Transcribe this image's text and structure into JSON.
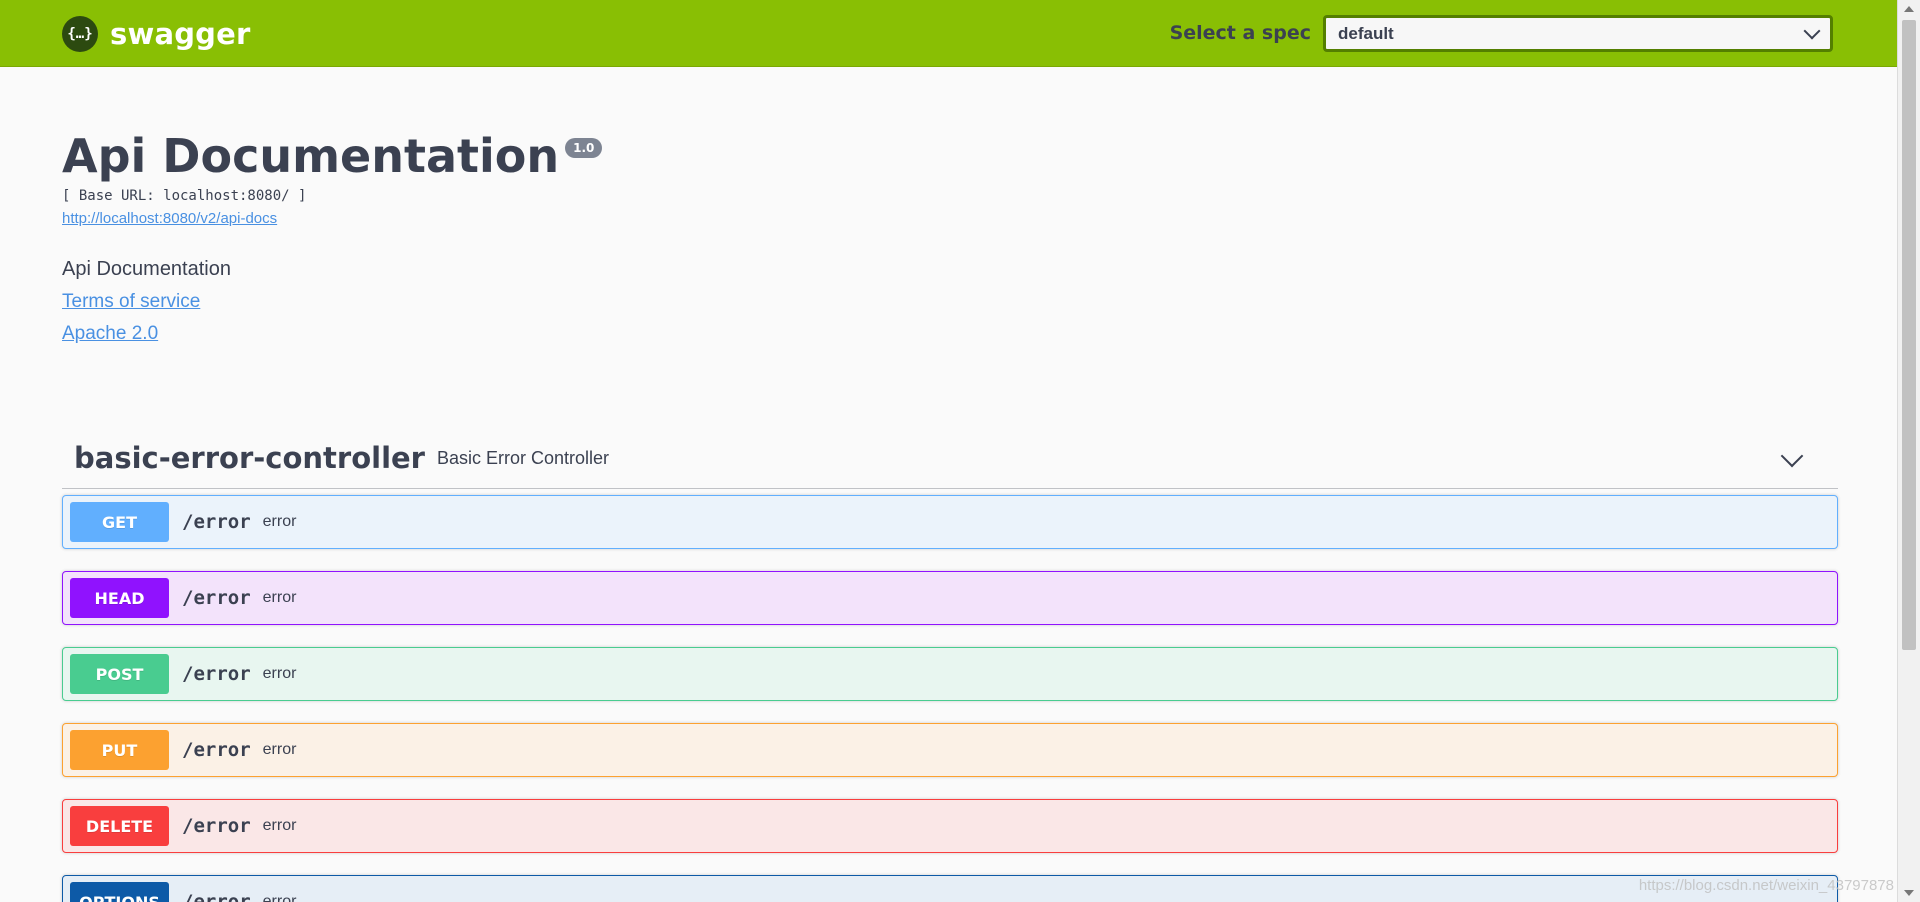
{
  "topbar": {
    "brand_icon": "{…}",
    "brand_name": "swagger",
    "spec_label": "Select a spec",
    "spec_selected": "default",
    "bg_color": "#89bf04"
  },
  "info": {
    "title": "Api Documentation",
    "version": "1.0",
    "base_url": "[ Base URL: localhost:8080/ ]",
    "docs_url": "http://localhost:8080/v2/api-docs",
    "description": "Api Documentation",
    "terms_link": "Terms of service",
    "license_link": "Apache 2.0"
  },
  "tag": {
    "name": "basic-error-controller",
    "description": "Basic Error Controller",
    "operations": [
      {
        "method": "GET",
        "path": "/error",
        "summary": "error",
        "color": "#61affe"
      },
      {
        "method": "HEAD",
        "path": "/error",
        "summary": "error",
        "color": "#9012fe"
      },
      {
        "method": "POST",
        "path": "/error",
        "summary": "error",
        "color": "#49cc90"
      },
      {
        "method": "PUT",
        "path": "/error",
        "summary": "error",
        "color": "#fca130"
      },
      {
        "method": "DELETE",
        "path": "/error",
        "summary": "error",
        "color": "#f93e3e"
      },
      {
        "method": "OPTIONS",
        "path": "/error",
        "summary": "error",
        "color": "#0d5aa7"
      }
    ]
  },
  "watermark": "https://blog.csdn.net/weixin_43797878"
}
